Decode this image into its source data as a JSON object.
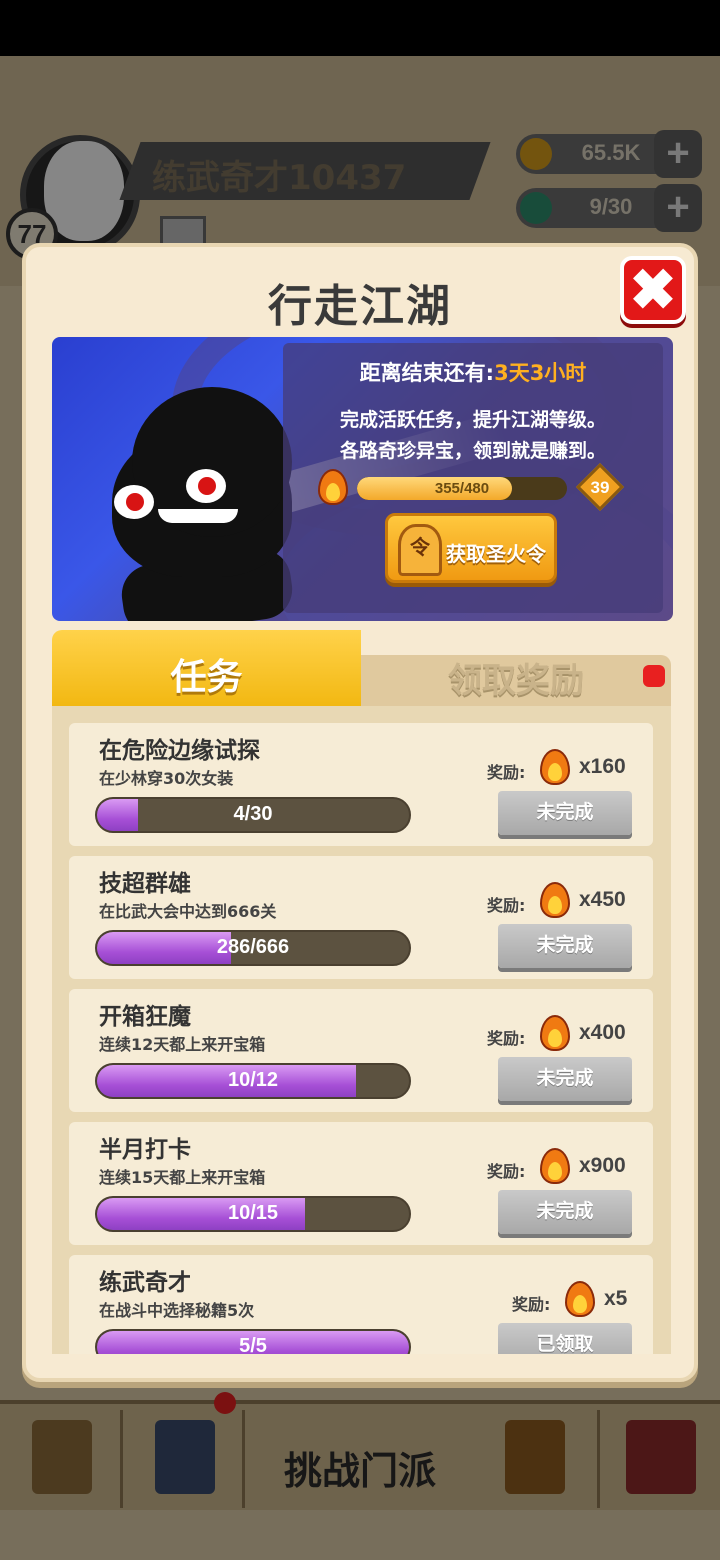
{
  "player": {
    "name": "练武奇才10437",
    "level": "77"
  },
  "resources": {
    "coins": "65.5K",
    "energy": "9/30"
  },
  "modal": {
    "title": "行走江湖",
    "close_icon": "close-x-icon"
  },
  "banner": {
    "countdown_prefix": "距离结束还有:",
    "countdown_value": "3天3小时",
    "desc_line1": "完成活跃任务，提升江湖等级。",
    "desc_line2": "各路奇珍异宝，领到就是赚到。",
    "xp_text": "355/480",
    "xp_fraction": 0.74,
    "level": "39",
    "get_token_button": "获取圣火令",
    "token_icon_char": "令"
  },
  "tabs": [
    {
      "label": "任务",
      "active": true
    },
    {
      "label": "领取奖励",
      "active": false,
      "has_notification": true
    }
  ],
  "reward_label": "奖励:",
  "tasks": [
    {
      "title": "在危险边缘试探",
      "desc": "在少林穿30次女装",
      "progress_text": "4/30",
      "fraction": 0.133,
      "reward": "x160",
      "button": "未完成"
    },
    {
      "title": "技超群雄",
      "desc": "在比武大会中达到666关",
      "progress_text": "286/666",
      "fraction": 0.43,
      "reward": "x450",
      "button": "未完成"
    },
    {
      "title": "开箱狂魔",
      "desc": "连续12天都上来开宝箱",
      "progress_text": "10/12",
      "fraction": 0.83,
      "reward": "x400",
      "button": "未完成"
    },
    {
      "title": "半月打卡",
      "desc": "连续15天都上来开宝箱",
      "progress_text": "10/15",
      "fraction": 0.667,
      "reward": "x900",
      "button": "未完成"
    },
    {
      "title": "练武奇才",
      "desc": "在战斗中选择秘籍5次",
      "progress_text": "5/5",
      "fraction": 1.0,
      "reward": "x5",
      "button": "已领取"
    }
  ],
  "bottom_nav": {
    "main_label": "挑战门派"
  },
  "colors": {
    "accent_yellow": "#f2b812",
    "progress_purple": "#a64fd6",
    "close_red": "#e21818",
    "highlight_orange": "#ffb020"
  }
}
